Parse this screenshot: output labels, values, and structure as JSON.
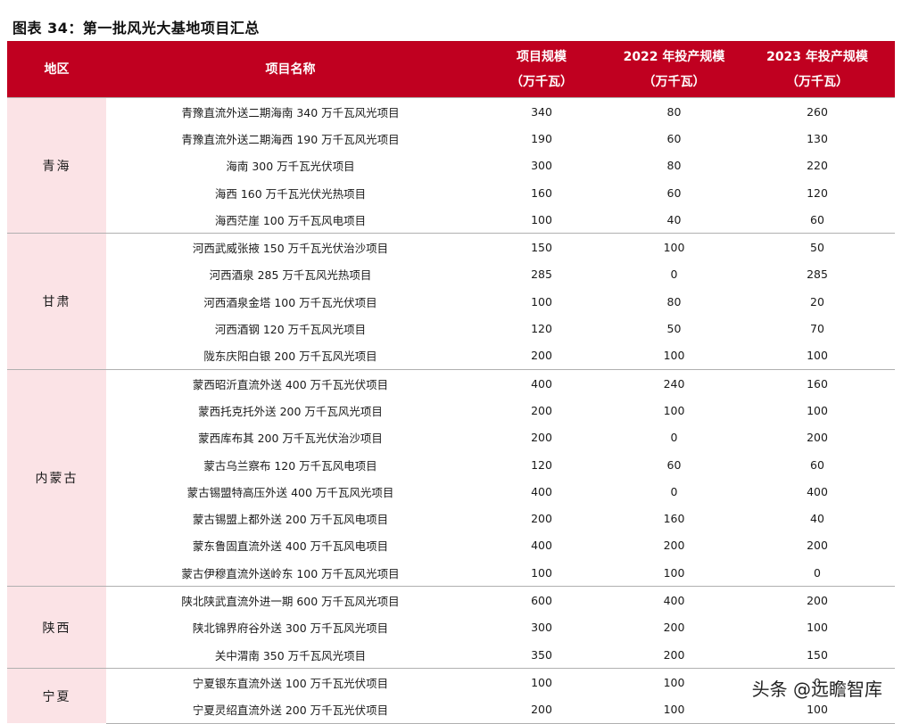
{
  "title": "图表 34：第一批风光大基地项目汇总",
  "columns": {
    "region": "地区",
    "project": "项目名称",
    "scale_line1": "项目规模",
    "scale_line2": "（万千瓦）",
    "y2022_line1": "2022 年投产规模",
    "y2022_line2": "（万千瓦）",
    "y2023_line1": "2023 年投产规模",
    "y2023_line2": "（万千瓦）"
  },
  "groups": [
    {
      "region": "青海",
      "rows": [
        {
          "project": "青豫直流外送二期海南 340 万千瓦风光项目",
          "scale": "340",
          "y2022": "80",
          "y2023": "260"
        },
        {
          "project": "青豫直流外送二期海西 190 万千瓦风光项目",
          "scale": "190",
          "y2022": "60",
          "y2023": "130"
        },
        {
          "project": "海南 300 万千瓦光伏项目",
          "scale": "300",
          "y2022": "80",
          "y2023": "220"
        },
        {
          "project": "海西 160 万千瓦光伏光热项目",
          "scale": "160",
          "y2022": "60",
          "y2023": "120"
        },
        {
          "project": "海西茫崖 100 万千瓦风电项目",
          "scale": "100",
          "y2022": "40",
          "y2023": "60"
        }
      ]
    },
    {
      "region": "甘肃",
      "rows": [
        {
          "project": "河西武威张掖 150 万千瓦光伏治沙项目",
          "scale": "150",
          "y2022": "100",
          "y2023": "50"
        },
        {
          "project": "河西酒泉 285 万千瓦风光热项目",
          "scale": "285",
          "y2022": "0",
          "y2023": "285"
        },
        {
          "project": "河西酒泉金塔 100 万千瓦光伏项目",
          "scale": "100",
          "y2022": "80",
          "y2023": "20"
        },
        {
          "project": "河西酒钢 120 万千瓦风光项目",
          "scale": "120",
          "y2022": "50",
          "y2023": "70"
        },
        {
          "project": "陇东庆阳白银 200 万千瓦风光项目",
          "scale": "200",
          "y2022": "100",
          "y2023": "100"
        }
      ]
    },
    {
      "region": "内蒙古",
      "rows": [
        {
          "project": "蒙西昭沂直流外送 400 万千瓦光伏项目",
          "scale": "400",
          "y2022": "240",
          "y2023": "160"
        },
        {
          "project": "蒙西托克托外送 200 万千瓦风光项目",
          "scale": "200",
          "y2022": "100",
          "y2023": "100"
        },
        {
          "project": "蒙西库布其 200 万千瓦光伏治沙项目",
          "scale": "200",
          "y2022": "0",
          "y2023": "200"
        },
        {
          "project": "蒙古乌兰察布 120 万千瓦风电项目",
          "scale": "120",
          "y2022": "60",
          "y2023": "60"
        },
        {
          "project": "蒙古锡盟特高压外送 400 万千瓦风光项目",
          "scale": "400",
          "y2022": "0",
          "y2023": "400"
        },
        {
          "project": "蒙古锡盟上都外送 200 万千瓦风电项目",
          "scale": "200",
          "y2022": "160",
          "y2023": "40"
        },
        {
          "project": "蒙东鲁固直流外送 400 万千瓦风电项目",
          "scale": "400",
          "y2022": "200",
          "y2023": "200"
        },
        {
          "project": "蒙古伊穆直流外送岭东 100 万千瓦风光项目",
          "scale": "100",
          "y2022": "100",
          "y2023": "0"
        }
      ]
    },
    {
      "region": "陕西",
      "rows": [
        {
          "project": "陕北陕武直流外进一期 600 万千瓦风光项目",
          "scale": "600",
          "y2022": "400",
          "y2023": "200"
        },
        {
          "project": "陕北锦界府谷外送 300 万千瓦风光项目",
          "scale": "300",
          "y2022": "200",
          "y2023": "100"
        },
        {
          "project": "关中渭南 350 万千瓦风光项目",
          "scale": "350",
          "y2022": "200",
          "y2023": "150"
        }
      ]
    },
    {
      "region": "宁夏",
      "rows": [
        {
          "project": "宁夏银东直流外送 100 万千瓦光伏项目",
          "scale": "100",
          "y2022": "100",
          "y2023": "0"
        },
        {
          "project": "宁夏灵绍直流外送 200 万千瓦光伏项目",
          "scale": "200",
          "y2022": "100",
          "y2023": "100"
        }
      ]
    }
  ],
  "watermark": "头条 @远瞻智库"
}
